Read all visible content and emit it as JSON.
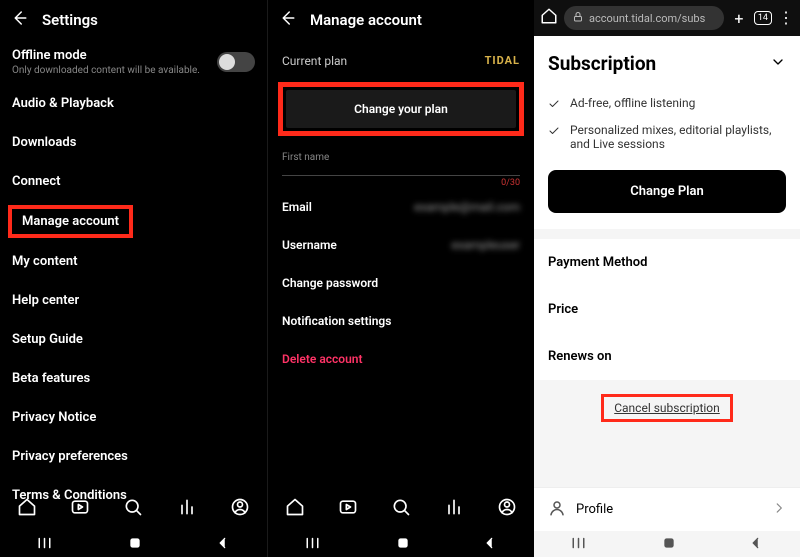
{
  "pane1": {
    "title": "Settings",
    "offline": {
      "label": "Offline mode",
      "sub": "Only downloaded content will be available."
    },
    "items": [
      "Audio & Playback",
      "Downloads",
      "Connect",
      "Manage account",
      "My content",
      "Help center",
      "Setup Guide",
      "Beta features",
      "Privacy Notice",
      "Privacy preferences",
      "Terms & Conditions"
    ]
  },
  "pane2": {
    "title": "Manage account",
    "currentPlanLabel": "Current plan",
    "planName": "TIDAL",
    "changePlan": "Change your plan",
    "firstNameLabel": "First name",
    "firstNameCount": "0/30",
    "emailLabel": "Email",
    "emailValue": "example@mail.com",
    "usernameLabel": "Username",
    "usernameValue": "exampleuser",
    "changePassword": "Change password",
    "notifications": "Notification settings",
    "deleteAccount": "Delete account"
  },
  "pane3": {
    "url": "account.tidal.com/subs",
    "tabCount": "14",
    "heading": "Subscription",
    "features": [
      "Ad-free, offline listening",
      "Personalized mixes, editorial playlists, and Live sessions"
    ],
    "changePlan": "Change Plan",
    "rows": [
      "Payment Method",
      "Price",
      "Renews on"
    ],
    "cancel": "Cancel subscription",
    "profile": "Profile"
  }
}
